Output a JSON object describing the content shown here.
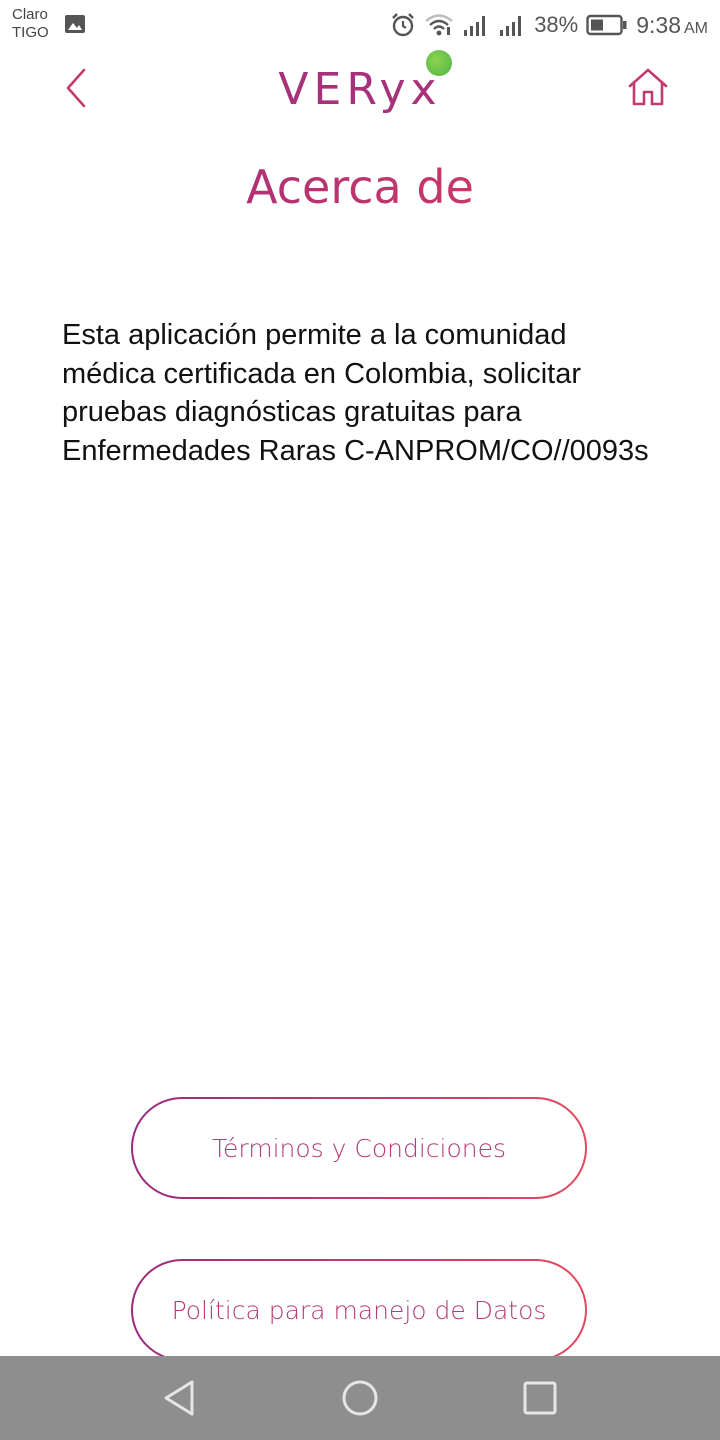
{
  "status_bar": {
    "carrier_line1": "Claro",
    "carrier_line2": "TIGO",
    "battery_percent": "38%",
    "time": "9:38",
    "ampm": "AM",
    "icons": [
      "gallery-icon",
      "alarm-icon",
      "wifi-icon",
      "signal-icon",
      "signal-icon",
      "battery-icon"
    ]
  },
  "header": {
    "logo_text": "VERyx",
    "back_icon": "chevron-left-icon",
    "home_icon": "home-icon",
    "accent_color": "#a8327a",
    "logo_dot_color": "#6cc24a"
  },
  "page": {
    "title": "Acerca de",
    "description": "Esta aplicación permite a la comunidad médica certificada en Colombia, solicitar pruebas diagnósticas gratuitas para Enfermedades Raras C-ANPROM/CO//0093s"
  },
  "buttons": {
    "terms_label": "Términos y Condiciones",
    "privacy_label": "Política para manejo de Datos"
  },
  "nav_bar": {
    "icons": [
      "nav-back-icon",
      "nav-home-icon",
      "nav-recent-icon"
    ]
  }
}
